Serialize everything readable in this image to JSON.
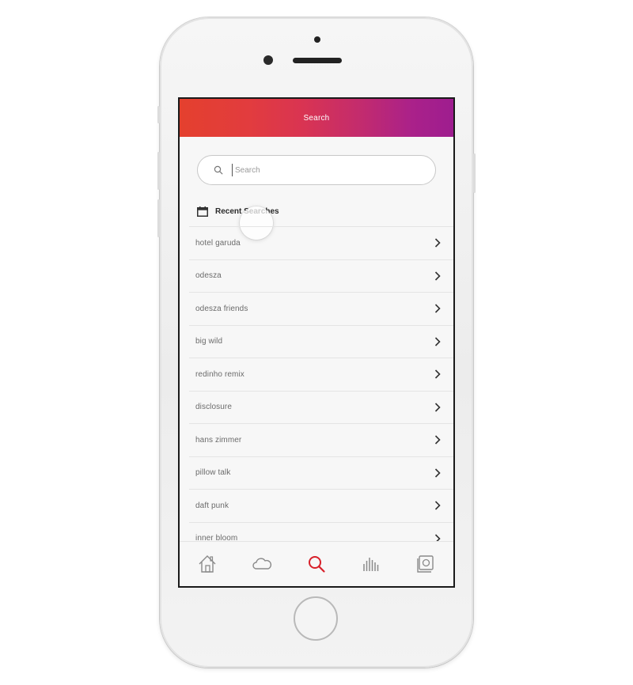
{
  "header": {
    "title": "Search"
  },
  "search": {
    "placeholder": "Search",
    "value": ""
  },
  "recent": {
    "title": "Recent Searches",
    "items": [
      {
        "label": "hotel garuda"
      },
      {
        "label": "odesza"
      },
      {
        "label": "odesza friends"
      },
      {
        "label": "big wild"
      },
      {
        "label": "redinho remix"
      },
      {
        "label": "disclosure"
      },
      {
        "label": "hans zimmer"
      },
      {
        "label": "pillow talk"
      },
      {
        "label": "daft punk"
      },
      {
        "label": "inner bloom"
      }
    ]
  },
  "tabbar": {
    "tabs": [
      {
        "icon": "home-icon",
        "active": false
      },
      {
        "icon": "cloud-icon",
        "active": false
      },
      {
        "icon": "search-icon",
        "active": true
      },
      {
        "icon": "equalizer-icon",
        "active": false
      },
      {
        "icon": "library-icon",
        "active": false
      }
    ]
  },
  "colors": {
    "header_gradient_start": "#e4402e",
    "header_gradient_end": "#9e1d8f",
    "active_tab": "#d8202a",
    "inactive_tab": "#8a8a8a"
  }
}
